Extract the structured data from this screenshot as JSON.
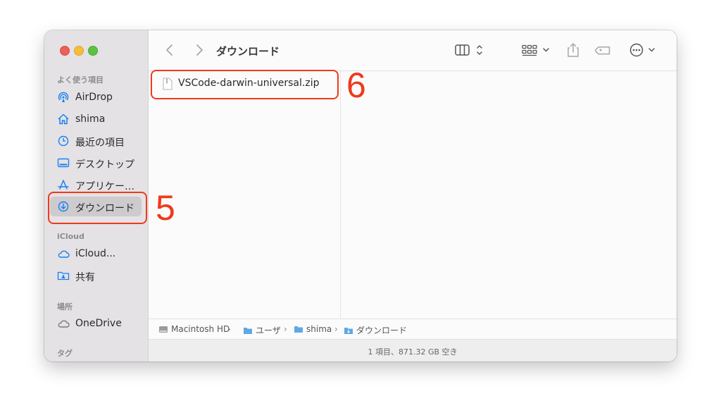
{
  "window": {
    "title": "ダウンロード"
  },
  "sidebar": {
    "favorites_header": "よく使う項目",
    "favorites": [
      {
        "label": "AirDrop",
        "icon": "airdrop-icon"
      },
      {
        "label": "shima",
        "icon": "home-icon"
      },
      {
        "label": "最近の項目",
        "icon": "clock-icon"
      },
      {
        "label": "デスクトップ",
        "icon": "desktop-icon"
      },
      {
        "label": "アプリケー…",
        "icon": "applications-icon"
      },
      {
        "label": "ダウンロード",
        "icon": "download-icon",
        "selected": true
      }
    ],
    "icloud_header": "iCloud",
    "icloud": [
      {
        "label": "iCloud...",
        "icon": "cloud-icon"
      },
      {
        "label": "共有",
        "icon": "shared-folder-icon"
      }
    ],
    "locations_header": "場所",
    "locations": [
      {
        "label": "OneDrive",
        "icon": "cloud-icon"
      }
    ],
    "tags_header": "タグ"
  },
  "files": [
    {
      "name": "VSCode-darwin-universal.zip",
      "icon": "zip-file-icon"
    }
  ],
  "pathbar": [
    "Macintosh HD",
    "ユーザ",
    "shima",
    "ダウンロード"
  ],
  "status": "1 項目、871.32 GB 空き",
  "annotations": {
    "sidebar_number": "5",
    "file_number": "6"
  },
  "colors": {
    "accent": "#1a7ff5",
    "annotation": "#ee3a1c"
  }
}
